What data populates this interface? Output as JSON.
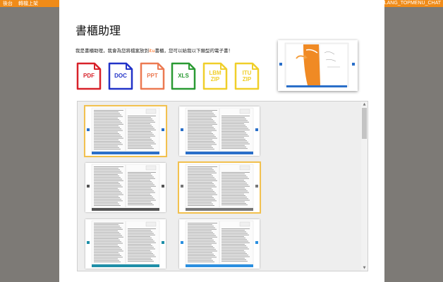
{
  "topbar": {
    "back_label": "後台",
    "upload_label": "轉檔上架",
    "right_label": "LANG_TOPMENU_CHAT"
  },
  "modal": {
    "title": "書櫃助理",
    "desc_before": "我是書櫃助理，我會為您將檔案放到",
    "desc_highlight": "itu",
    "desc_after": "書櫃，您可以給我以下類型的電子書！"
  },
  "file_types": [
    {
      "label": "PDF",
      "color": "#d8222a"
    },
    {
      "label": "DOC",
      "color": "#2233c8"
    },
    {
      "label": "PPT",
      "color": "#ec7a52"
    },
    {
      "label": "XLS",
      "color": "#2a9a33"
    },
    {
      "label": "LBM\nZIP",
      "color": "#f0cf2a"
    },
    {
      "label": "ITU\nZIP",
      "color": "#f0cf2a"
    }
  ],
  "templates": [
    {
      "selected": true,
      "accent": "#2a6fc9"
    },
    {
      "selected": false,
      "accent": "#2a6fc9"
    },
    {
      "selected": false,
      "accent": "#555555"
    },
    {
      "selected": true,
      "accent": "#777777"
    },
    {
      "selected": false,
      "accent": "#1e8fa8"
    },
    {
      "selected": false,
      "accent": "#2a8fe0"
    }
  ]
}
